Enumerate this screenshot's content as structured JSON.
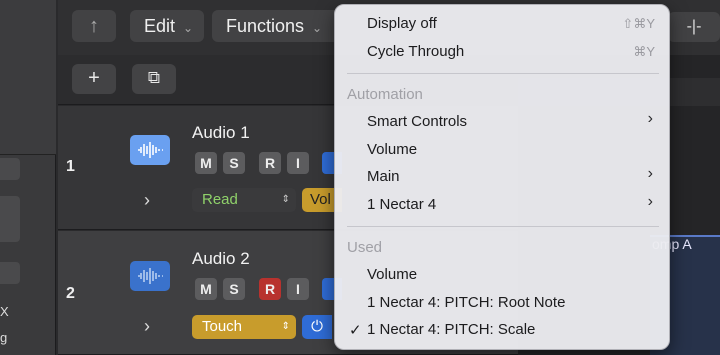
{
  "toolbar": {
    "back_icon": "↑",
    "edit_label": "Edit",
    "functions_label": "Functions",
    "right_icon": "-|-"
  },
  "bar2": {
    "add_label": "+",
    "duplicate_icon": "⧉"
  },
  "tracks": [
    {
      "number": "1",
      "name": "Audio 1",
      "icon_color": "#6aa0f0",
      "buttons": [
        "M",
        "S",
        "R",
        "I"
      ],
      "record_armed": false,
      "automation_mode": "Read",
      "automation_mode_color": "#3c3c3e",
      "automation_mode_text_color": "#8fd16a",
      "parameter_stub": "Vol"
    },
    {
      "number": "2",
      "name": "Audio 2",
      "icon_color": "#3a72cc",
      "buttons": [
        "M",
        "S",
        "R",
        "I"
      ],
      "record_armed": true,
      "automation_mode": "Touch",
      "automation_mode_color": "#c89c2c",
      "automation_mode_text_color": "#ffffff",
      "parameter_stub": "⏻"
    }
  ],
  "region": {
    "title": "omp A"
  },
  "left_strip": {
    "glyph_x": "X",
    "glyph_g": "g"
  },
  "menu": {
    "items_top": [
      {
        "label": "Display off",
        "shortcut": "⇧⌘Y"
      },
      {
        "label": "Cycle Through",
        "shortcut": "⌘Y"
      }
    ],
    "automation_header": "Automation",
    "automation_items": [
      {
        "label": "Smart Controls",
        "submenu": true
      },
      {
        "label": "Volume",
        "submenu": false
      },
      {
        "label": "Main",
        "submenu": true
      },
      {
        "label": "1 Nectar 4",
        "submenu": true
      }
    ],
    "used_header": "Used",
    "used_items": [
      {
        "label": "Volume",
        "checked": false
      },
      {
        "label": "1 Nectar 4: PITCH: Root Note",
        "checked": false
      },
      {
        "label": "1 Nectar 4: PITCH: Scale",
        "checked": true
      }
    ],
    "submenu_glyph": "›",
    "check_glyph": "✓"
  }
}
